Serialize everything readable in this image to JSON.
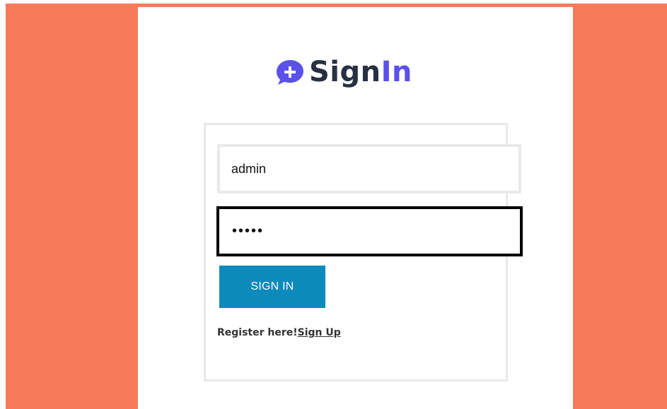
{
  "brand": {
    "title_part1": "Sign",
    "title_part2": "In",
    "icon": "chat-plus-icon",
    "accent_color": "#5a50ea",
    "dark_text_color": "#273142"
  },
  "form": {
    "username_value": "admin",
    "password_value": "•••••",
    "submit_label": "SIGN IN"
  },
  "register": {
    "prompt_text": "Register here!",
    "link_label": "Sign Up"
  },
  "colors": {
    "page_background": "#f77b5b",
    "button_background": "#0d8abc",
    "focused_border": "#000000"
  }
}
